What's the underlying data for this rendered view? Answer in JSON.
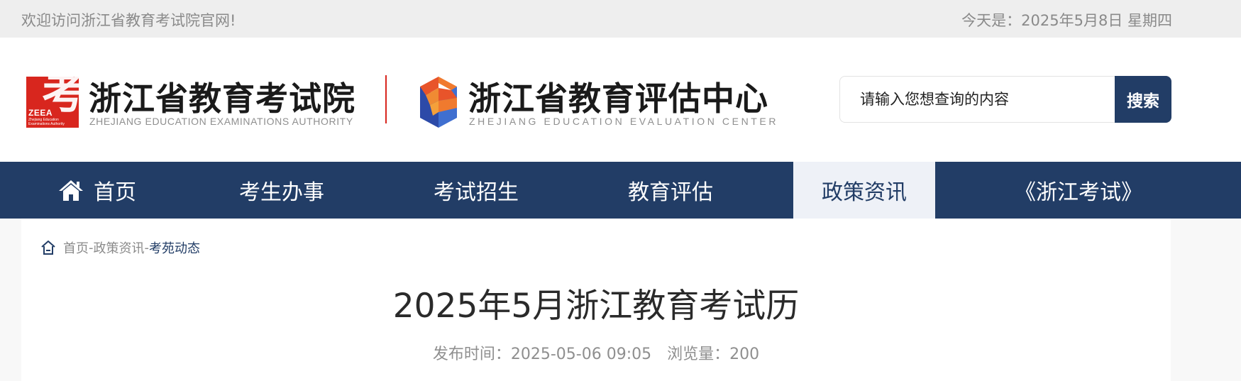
{
  "topbar": {
    "welcome": "欢迎访问浙江省教育考试院官网!",
    "today": "今天是：2025年5月8日 星期四"
  },
  "logos": {
    "ZEEA": {
      "mark_char": "考",
      "mark_abbr": "ZEEA",
      "mark_tiny_line1": "Zhejiang Education",
      "mark_tiny_line2": "Examinations Authority",
      "name": "浙江省教育考试院",
      "english": "ZHEJIANG EDUCATION EXAMINATIONS AUTHORITY"
    },
    "ZEEC": {
      "name": "浙江省教育评估中心",
      "english": "ZHEJIANG EDUCATION EVALUATION CENTER"
    }
  },
  "search": {
    "placeholder": "请输入您想查询的内容",
    "button_label": "搜索"
  },
  "nav": {
    "items": [
      {
        "label": "首页",
        "icon": "home-icon"
      },
      {
        "label": "考生办事"
      },
      {
        "label": "考试招生"
      },
      {
        "label": "教育评估"
      },
      {
        "label": "政策资讯",
        "active": true
      },
      {
        "label": "《浙江考试》"
      }
    ]
  },
  "breadcrumb": {
    "icon": "home-outline-icon",
    "parts": [
      "首页",
      "-",
      "政策资讯",
      "-",
      "考苑动态"
    ]
  },
  "article": {
    "title": "2025年5月浙江教育考试历",
    "publish_label": "发布时间：",
    "publish_time": "2025-05-06 09:05",
    "views_label": "浏览量：",
    "views": "200"
  },
  "colors": {
    "primary_navy": "#223d66",
    "brand_red": "#d8261e",
    "topbar_bg": "#eeeeee",
    "muted_text": "#8a8a8a"
  }
}
